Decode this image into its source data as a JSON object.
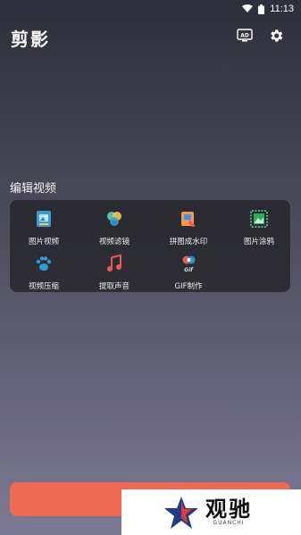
{
  "status": {
    "time": "11:13",
    "wifi_icon": "wifi-icon",
    "battery_icon": "battery-icon"
  },
  "app": {
    "title": "剪影",
    "ad_icon": "ad-icon",
    "ad_text": "AD",
    "settings_icon": "gear-icon"
  },
  "section": {
    "title": "编辑视频"
  },
  "tools": [
    {
      "label": "图片视频",
      "icon": "photo-video-icon"
    },
    {
      "label": "视频滤镜",
      "icon": "video-filter-icon"
    },
    {
      "label": "拼图成水印",
      "icon": "puzzle-watermark-icon"
    },
    {
      "label": "图片涂鸦",
      "icon": "photo-doodle-icon"
    },
    {
      "label": "视频压缩",
      "icon": "paw-compress-icon"
    },
    {
      "label": "提取声音",
      "icon": "music-note-icon"
    },
    {
      "label": "GIF制作",
      "icon": "gif-icon",
      "icon_text": "Gif"
    }
  ],
  "watermark": {
    "main": "观驰",
    "sub": "GUANCHI"
  },
  "colors": {
    "accent": "#ef6a52",
    "card": "#1e1e22"
  }
}
